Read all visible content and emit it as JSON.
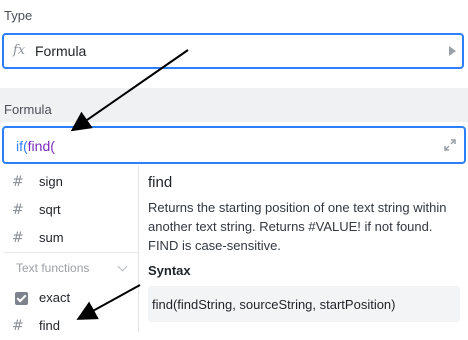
{
  "type_section": {
    "label": "Type",
    "fx_icon": "fx",
    "value": "Formula"
  },
  "formula_section": {
    "label": "Formula",
    "input_prefix": "if(",
    "input_suffix": "find(",
    "prefix_color": "#2d7ff9",
    "suffix_color": "#7b2cbf"
  },
  "function_list": {
    "items": [
      {
        "label": "sign",
        "icon": "hash-icon"
      },
      {
        "label": "sqrt",
        "icon": "hash-icon"
      },
      {
        "label": "sum",
        "icon": "hash-icon"
      }
    ],
    "section_header": "Text functions",
    "text_items": [
      {
        "label": "exact",
        "icon": "checkbox-icon"
      },
      {
        "label": "find",
        "icon": "hash-icon"
      }
    ]
  },
  "detail": {
    "title": "find",
    "description": "Returns the starting position of one text string within another text string. Returns #VALUE! if not found. FIND is case-sensitive.",
    "syntax_label": "Syntax",
    "syntax": "find(findString, sourceString, startPosition)"
  },
  "colors": {
    "accent": "#2d7ff9",
    "arrow": "#000000"
  }
}
